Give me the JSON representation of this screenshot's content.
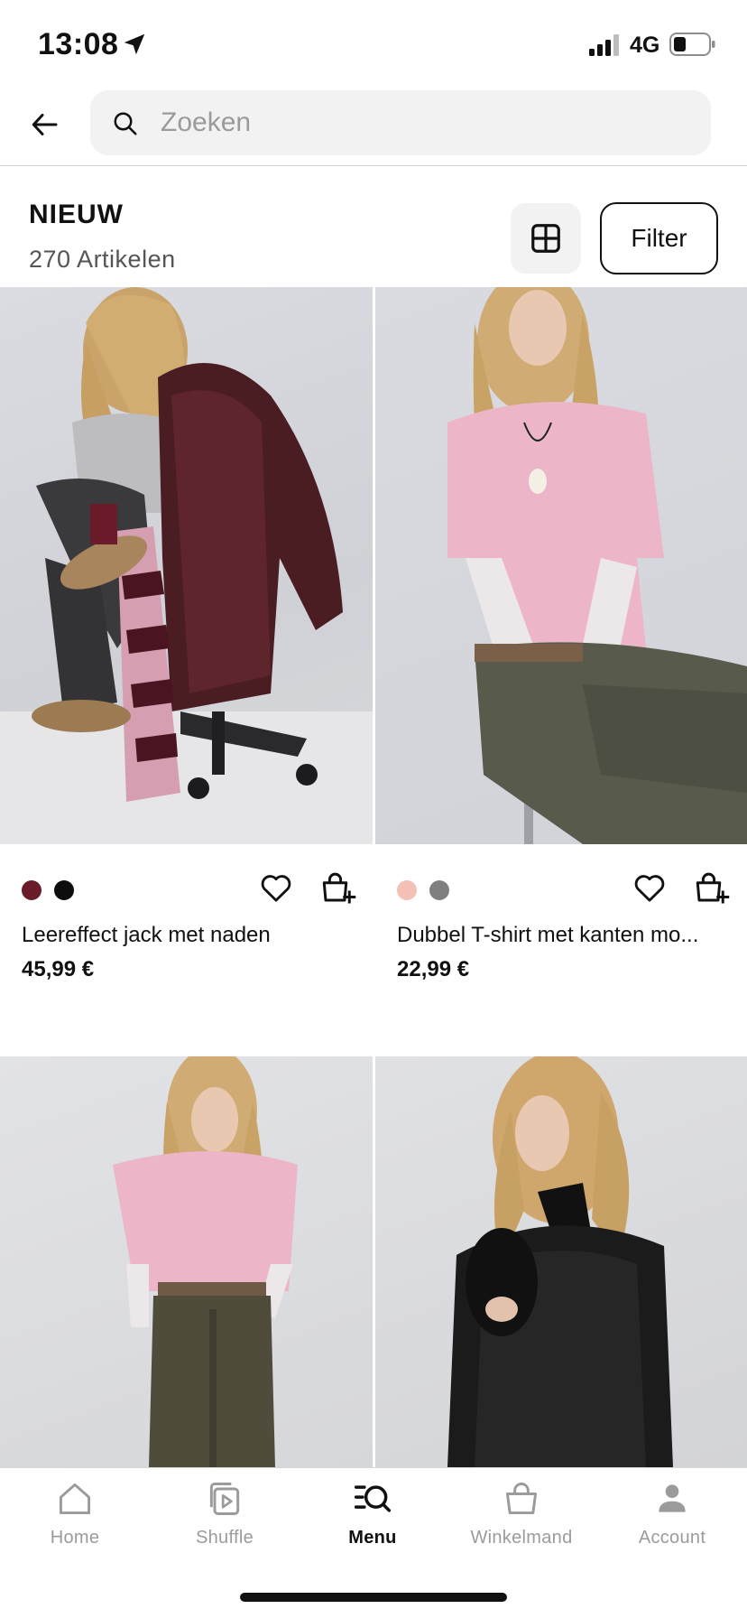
{
  "status_bar": {
    "time": "13:08",
    "network": "4G",
    "icons": [
      "location-arrow-icon",
      "signal-icon",
      "battery-icon"
    ]
  },
  "header": {
    "back_icon": "arrow-left-icon",
    "search": {
      "placeholder": "Zoeken",
      "value": "",
      "icon": "search-icon"
    }
  },
  "section": {
    "title": "NIEUW",
    "count": "270 Artikelen",
    "layout_icon": "grid-layout-icon",
    "filter_label": "Filter"
  },
  "products": [
    {
      "name": "Leereffect jack met naden",
      "price": "45,99 €",
      "swatches": [
        "#6b1c2b",
        "#0d0d0d"
      ],
      "image": "model-leather-jacket-photo"
    },
    {
      "name": "Dubbel T-shirt met kanten mo...",
      "price": "22,99 €",
      "swatches": [
        "#f2c0b4",
        "#7f7f7f"
      ],
      "image": "model-pink-tshirt-photo"
    },
    {
      "image": "model-pink-tshirt-front-photo"
    },
    {
      "image": "model-black-jacket-photo"
    }
  ],
  "bottom_nav": {
    "items": [
      {
        "label": "Home",
        "icon": "home-icon",
        "active": false
      },
      {
        "label": "Shuffle",
        "icon": "shuffle-icon",
        "active": false
      },
      {
        "label": "Menu",
        "icon": "menu-search-icon",
        "active": true
      },
      {
        "label": "Winkelmand",
        "icon": "shopping-bag-icon",
        "active": false
      },
      {
        "label": "Account",
        "icon": "account-icon",
        "active": false
      }
    ]
  },
  "colors": {
    "text": "#111111",
    "muted": "#9b9b9b",
    "search_bg": "#f2f2f2"
  }
}
